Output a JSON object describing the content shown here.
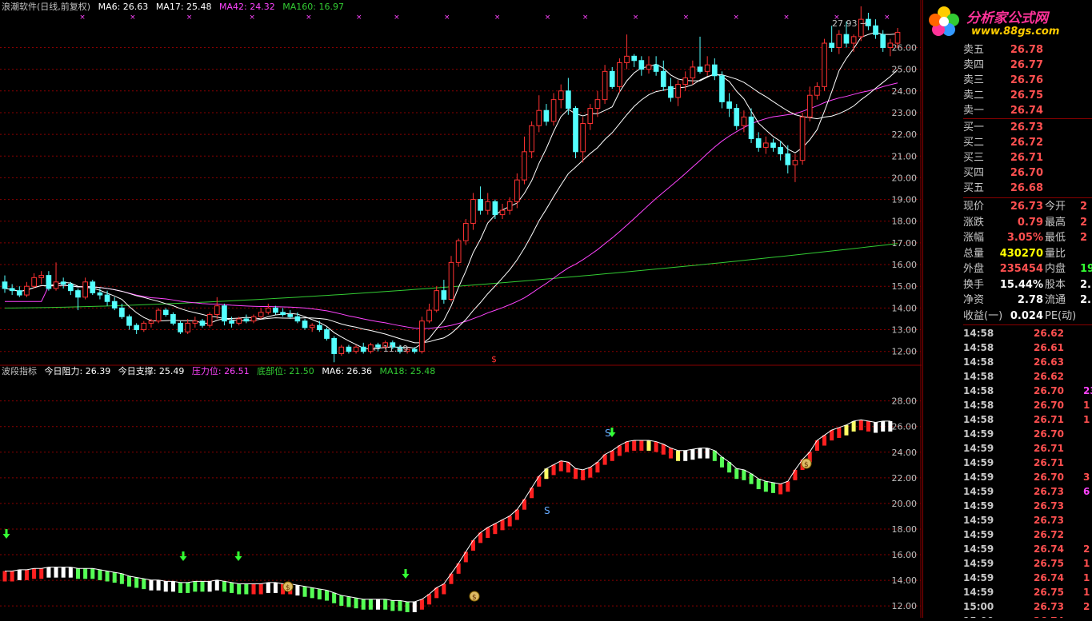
{
  "colors": {
    "up": "#ff3232",
    "down": "#54ffff",
    "ma6": "#ffffff",
    "ma17": "#ffffff",
    "ma42": "#ff44ff",
    "ma160": "#33cc33",
    "grid": "#8a0000",
    "axis": "#c0c0c0"
  },
  "header": {
    "title": "浪潮软件(日线,前复权)",
    "ma6": "MA6: 26.63",
    "ma17": "MA17: 25.48",
    "ma42": "MA42: 24.32",
    "ma160": "MA160: 16.97"
  },
  "sub_header": {
    "name": "波段指标",
    "resist": "今日阻力: 26.39",
    "support": "今日支撑: 25.49",
    "press": "压力位: 26.51",
    "bottom": "底部位: 21.50",
    "ma6": "MA6: 26.36",
    "ma18": "MA18: 25.48"
  },
  "price_axis": {
    "ticks": [
      "26.00",
      "25.00",
      "24.00",
      "23.00",
      "22.00",
      "21.00",
      "20.00",
      "19.00",
      "18.00",
      "17.00",
      "16.00",
      "15.00",
      "14.00",
      "13.00",
      "12.00"
    ]
  },
  "indicator_axis": {
    "ticks": [
      "28.00",
      "26.00",
      "24.00",
      "22.00",
      "20.00",
      "18.00",
      "16.00",
      "14.00",
      "12.00"
    ]
  },
  "annotations": {
    "high": "27.93",
    "low": "11.49",
    "s_marker": "S",
    "dollar": "$"
  },
  "chart_data": {
    "type": "candlestick",
    "ylim": [
      11.4,
      27.6
    ],
    "candles": [
      [
        15.2,
        15.5,
        14.7,
        14.9
      ],
      [
        14.9,
        15.1,
        14.6,
        14.8
      ],
      [
        14.8,
        15.0,
        14.5,
        14.6
      ],
      [
        14.6,
        15.2,
        14.5,
        15.0
      ],
      [
        15.0,
        15.6,
        14.9,
        15.4
      ],
      [
        15.4,
        15.7,
        15.1,
        15.5
      ],
      [
        15.5,
        15.7,
        14.8,
        14.9
      ],
      [
        14.9,
        16.1,
        14.8,
        15.2
      ],
      [
        15.2,
        15.4,
        14.9,
        15.1
      ],
      [
        15.1,
        15.2,
        14.6,
        14.8
      ],
      [
        14.8,
        14.9,
        13.9,
        14.5
      ],
      [
        14.5,
        15.4,
        14.4,
        15.2
      ],
      [
        15.2,
        15.3,
        14.6,
        14.7
      ],
      [
        14.7,
        14.9,
        14.4,
        14.6
      ],
      [
        14.6,
        14.8,
        14.1,
        14.3
      ],
      [
        14.3,
        14.5,
        13.9,
        14.0
      ],
      [
        14.0,
        14.2,
        13.5,
        13.6
      ],
      [
        13.6,
        13.7,
        13.0,
        13.2
      ],
      [
        13.2,
        13.3,
        12.8,
        13.0
      ],
      [
        13.0,
        13.4,
        12.9,
        13.3
      ],
      [
        13.3,
        13.5,
        13.1,
        13.4
      ],
      [
        13.4,
        14.0,
        13.3,
        13.9
      ],
      [
        13.9,
        14.0,
        13.6,
        13.7
      ],
      [
        13.7,
        13.8,
        13.2,
        13.3
      ],
      [
        13.3,
        13.4,
        12.8,
        12.9
      ],
      [
        12.9,
        13.5,
        12.8,
        13.3
      ],
      [
        13.3,
        13.6,
        13.1,
        13.4
      ],
      [
        13.4,
        13.5,
        13.1,
        13.2
      ],
      [
        13.2,
        13.8,
        13.1,
        13.7
      ],
      [
        13.7,
        14.5,
        13.5,
        14.1
      ],
      [
        14.1,
        14.2,
        13.2,
        13.4
      ],
      [
        13.4,
        13.6,
        13.1,
        13.3
      ],
      [
        13.3,
        13.6,
        13.2,
        13.5
      ],
      [
        13.5,
        13.7,
        13.3,
        13.4
      ],
      [
        13.4,
        13.7,
        13.3,
        13.6
      ],
      [
        13.6,
        14.0,
        13.5,
        13.8
      ],
      [
        13.8,
        14.2,
        13.7,
        14.0
      ],
      [
        14.0,
        14.1,
        13.7,
        13.8
      ],
      [
        13.8,
        14.0,
        13.6,
        13.7
      ],
      [
        13.7,
        13.9,
        13.5,
        13.6
      ],
      [
        13.6,
        13.8,
        13.3,
        13.4
      ],
      [
        13.4,
        13.5,
        13.0,
        13.1
      ],
      [
        13.1,
        13.3,
        12.9,
        13.2
      ],
      [
        13.2,
        13.4,
        12.9,
        13.0
      ],
      [
        13.0,
        13.1,
        12.5,
        12.6
      ],
      [
        12.6,
        12.7,
        11.5,
        11.9
      ],
      [
        11.9,
        12.3,
        11.8,
        12.2
      ],
      [
        12.2,
        12.3,
        11.9,
        12.0
      ],
      [
        12.0,
        12.3,
        11.9,
        12.2
      ],
      [
        12.2,
        12.4,
        11.9,
        12.0
      ],
      [
        12.0,
        12.4,
        11.9,
        12.3
      ],
      [
        12.3,
        12.4,
        12.0,
        12.2
      ],
      [
        12.2,
        12.5,
        12.1,
        12.4
      ],
      [
        12.4,
        12.5,
        12.1,
        12.2
      ],
      [
        12.2,
        12.3,
        11.9,
        12.0
      ],
      [
        12.0,
        12.2,
        11.9,
        12.1
      ],
      [
        12.1,
        12.2,
        11.9,
        12.0
      ],
      [
        12.0,
        13.6,
        11.9,
        13.4
      ],
      [
        13.4,
        14.2,
        13.3,
        13.9
      ],
      [
        13.9,
        15.0,
        13.8,
        14.8
      ],
      [
        14.8,
        15.3,
        14.2,
        14.4
      ],
      [
        14.4,
        16.4,
        14.3,
        16.1
      ],
      [
        16.1,
        17.2,
        15.9,
        17.1
      ],
      [
        17.1,
        18.1,
        16.9,
        17.9
      ],
      [
        17.9,
        19.3,
        17.6,
        19.0
      ],
      [
        19.0,
        19.6,
        18.3,
        18.5
      ],
      [
        18.5,
        19.3,
        18.3,
        18.9
      ],
      [
        18.9,
        19.0,
        18.1,
        18.3
      ],
      [
        18.3,
        18.8,
        18.1,
        18.5
      ],
      [
        18.5,
        19.1,
        18.3,
        18.9
      ],
      [
        18.9,
        20.2,
        18.6,
        19.9
      ],
      [
        19.9,
        21.9,
        19.7,
        21.2
      ],
      [
        21.2,
        22.6,
        20.9,
        22.4
      ],
      [
        22.4,
        23.8,
        22.1,
        23.1
      ],
      [
        23.1,
        23.4,
        22.4,
        22.6
      ],
      [
        22.6,
        23.9,
        22.4,
        23.6
      ],
      [
        23.6,
        24.3,
        23.2,
        24.0
      ],
      [
        24.0,
        24.6,
        22.9,
        23.2
      ],
      [
        23.2,
        23.3,
        20.9,
        21.2
      ],
      [
        21.2,
        22.8,
        20.7,
        22.5
      ],
      [
        22.5,
        23.4,
        22.2,
        23.2
      ],
      [
        23.2,
        24.0,
        22.8,
        23.6
      ],
      [
        23.6,
        25.2,
        23.4,
        24.9
      ],
      [
        24.9,
        25.1,
        24.1,
        24.2
      ],
      [
        24.2,
        25.5,
        23.9,
        25.3
      ],
      [
        25.3,
        26.6,
        25.0,
        25.6
      ],
      [
        25.6,
        25.7,
        25.1,
        25.4
      ],
      [
        25.4,
        25.6,
        24.7,
        25.0
      ],
      [
        25.0,
        25.6,
        24.8,
        25.2
      ],
      [
        25.2,
        25.6,
        24.7,
        24.9
      ],
      [
        24.9,
        25.4,
        24.0,
        24.2
      ],
      [
        24.2,
        24.6,
        23.5,
        23.7
      ],
      [
        23.7,
        24.5,
        23.3,
        24.3
      ],
      [
        24.3,
        24.9,
        24.0,
        24.6
      ],
      [
        24.6,
        25.4,
        24.3,
        25.1
      ],
      [
        25.1,
        26.5,
        24.8,
        24.9
      ],
      [
        24.9,
        25.6,
        24.7,
        25.2
      ],
      [
        25.2,
        25.5,
        24.5,
        24.7
      ],
      [
        24.7,
        24.9,
        23.2,
        23.5
      ],
      [
        23.5,
        23.9,
        22.8,
        23.2
      ],
      [
        23.2,
        23.4,
        22.2,
        22.4
      ],
      [
        22.4,
        23.1,
        22.1,
        22.8
      ],
      [
        22.8,
        23.2,
        21.6,
        21.8
      ],
      [
        21.8,
        22.1,
        21.2,
        21.4
      ],
      [
        21.4,
        21.9,
        21.1,
        21.6
      ],
      [
        21.6,
        21.8,
        21.2,
        21.4
      ],
      [
        21.4,
        21.7,
        20.8,
        21.1
      ],
      [
        21.1,
        21.5,
        20.2,
        20.6
      ],
      [
        20.6,
        21.1,
        19.8,
        20.8
      ],
      [
        20.8,
        23.0,
        20.6,
        22.8
      ],
      [
        22.8,
        24.2,
        22.6,
        23.8
      ],
      [
        23.8,
        24.4,
        23.6,
        24.2
      ],
      [
        24.2,
        26.4,
        24.0,
        26.2
      ],
      [
        26.2,
        27.0,
        25.8,
        26.0
      ],
      [
        26.0,
        26.8,
        25.7,
        26.6
      ],
      [
        26.6,
        27.2,
        26.0,
        26.2
      ],
      [
        26.2,
        26.6,
        25.8,
        26.5
      ],
      [
        26.5,
        27.9,
        26.3,
        27.3
      ],
      [
        27.3,
        27.6,
        26.8,
        27.0
      ],
      [
        27.0,
        27.3,
        26.4,
        26.6
      ],
      [
        26.6,
        26.8,
        25.8,
        26.0
      ],
      [
        26.0,
        26.4,
        25.6,
        26.2
      ],
      [
        26.2,
        26.9,
        26.0,
        26.7
      ]
    ]
  },
  "indicator_data": {
    "ylim": [
      11.2,
      29.6
    ],
    "values": [
      14.6,
      14.6,
      14.7,
      14.7,
      14.8,
      14.8,
      14.9,
      14.9,
      14.9,
      14.9,
      14.8,
      14.8,
      14.8,
      14.7,
      14.6,
      14.5,
      14.4,
      14.2,
      14.1,
      14.0,
      13.9,
      13.9,
      13.8,
      13.8,
      13.7,
      13.7,
      13.8,
      13.8,
      13.8,
      13.9,
      13.8,
      13.7,
      13.6,
      13.6,
      13.6,
      13.6,
      13.7,
      13.7,
      13.6,
      13.6,
      13.5,
      13.4,
      13.3,
      13.2,
      13.1,
      12.9,
      12.7,
      12.6,
      12.5,
      12.4,
      12.4,
      12.4,
      12.4,
      12.3,
      12.3,
      12.2,
      12.2,
      12.4,
      12.8,
      13.3,
      13.6,
      14.4,
      15.2,
      16.1,
      17.0,
      17.6,
      18.0,
      18.3,
      18.6,
      18.9,
      19.4,
      20.2,
      21.1,
      22.0,
      22.6,
      22.9,
      23.2,
      23.1,
      22.6,
      22.5,
      22.7,
      23.1,
      23.7,
      24.0,
      24.4,
      24.7,
      24.8,
      24.8,
      24.8,
      24.7,
      24.5,
      24.2,
      24.0,
      24.0,
      24.1,
      24.2,
      24.2,
      24.0,
      23.5,
      23.1,
      22.6,
      22.5,
      22.2,
      21.8,
      21.6,
      21.5,
      21.4,
      21.6,
      22.5,
      23.3,
      23.9,
      24.8,
      25.2,
      25.6,
      25.8,
      26.0,
      26.3,
      26.4,
      26.3,
      26.2,
      26.3,
      26.3
    ],
    "states": [
      "r",
      "r",
      "w",
      "r",
      "r",
      "r",
      "w",
      "w",
      "w",
      "w",
      "g",
      "g",
      "g",
      "g",
      "g",
      "g",
      "g",
      "g",
      "g",
      "g",
      "w",
      "w",
      "w",
      "w",
      "g",
      "g",
      "g",
      "g",
      "w",
      "w",
      "g",
      "g",
      "g",
      "g",
      "r",
      "r",
      "w",
      "w",
      "r",
      "r",
      "w",
      "g",
      "g",
      "g",
      "g",
      "g",
      "g",
      "g",
      "g",
      "g",
      "g",
      "w",
      "g",
      "g",
      "g",
      "g",
      "w",
      "r",
      "r",
      "r",
      "r",
      "r",
      "r",
      "r",
      "r",
      "r",
      "r",
      "r",
      "r",
      "r",
      "r",
      "r",
      "r",
      "r",
      "y",
      "r",
      "r",
      "r",
      "r",
      "r",
      "r",
      "r",
      "r",
      "r",
      "r",
      "r",
      "r",
      "r",
      "y",
      "r",
      "r",
      "r",
      "y",
      "w",
      "w",
      "w",
      "w",
      "g",
      "g",
      "g",
      "g",
      "g",
      "g",
      "g",
      "g",
      "g",
      "r",
      "r",
      "r",
      "r",
      "r",
      "r",
      "r",
      "r",
      "r",
      "y",
      "y",
      "r",
      "r"
    ]
  },
  "quote": {
    "asks": [
      {
        "label": "卖五",
        "price": "26.78"
      },
      {
        "label": "卖四",
        "price": "26.77"
      },
      {
        "label": "卖三",
        "price": "26.76"
      },
      {
        "label": "卖二",
        "price": "26.75"
      },
      {
        "label": "卖一",
        "price": "26.74"
      }
    ],
    "bids": [
      {
        "label": "买一",
        "price": "26.73"
      },
      {
        "label": "买二",
        "price": "26.72"
      },
      {
        "label": "买三",
        "price": "26.71"
      },
      {
        "label": "买四",
        "price": "26.70"
      },
      {
        "label": "买五",
        "price": "26.68"
      }
    ],
    "stats": [
      {
        "l1": "现价",
        "v1": "26.73",
        "c1": "#ff5050",
        "l2": "今开",
        "v2": "2",
        "c2": "#ff5050"
      },
      {
        "l1": "涨跌",
        "v1": "0.79",
        "c1": "#ff5050",
        "l2": "最高",
        "v2": "2",
        "c2": "#ff5050"
      },
      {
        "l1": "涨幅",
        "v1": "3.05%",
        "c1": "#ff5050",
        "l2": "最低",
        "v2": "2",
        "c2": "#ff5050"
      },
      {
        "l1": "总量",
        "v1": "430270",
        "c1": "#ffff00",
        "l2": "量比",
        "v2": "",
        "c2": "#ff5050"
      },
      {
        "l1": "外盘",
        "v1": "235454",
        "c1": "#ff5050",
        "l2": "内盘",
        "v2": "19",
        "c2": "#33ff33"
      },
      {
        "l1": "换手",
        "v1": "15.44%",
        "c1": "#ffffff",
        "l2": "股本",
        "v2": "2.",
        "c2": "#ffffff"
      },
      {
        "l1": "净资",
        "v1": "2.78",
        "c1": "#ffffff",
        "l2": "流通",
        "v2": "2.",
        "c2": "#ffffff"
      },
      {
        "l1": "收益(一)",
        "v1": "0.024",
        "c1": "#ffffff",
        "l2": "PE(动)",
        "v2": "",
        "c2": "#ffffff"
      }
    ],
    "ticks": [
      {
        "t": "14:58",
        "p": "26.62",
        "v": "",
        "vc": "#ff5050"
      },
      {
        "t": "14:58",
        "p": "26.61",
        "v": "",
        "vc": "#ff5050"
      },
      {
        "t": "14:58",
        "p": "26.63",
        "v": "",
        "vc": "#ff5050"
      },
      {
        "t": "14:58",
        "p": "26.62",
        "v": "",
        "vc": "#ff5050"
      },
      {
        "t": "14:58",
        "p": "26.70",
        "v": "23",
        "vc": "#ff44ff"
      },
      {
        "t": "14:58",
        "p": "26.70",
        "v": "1",
        "vc": "#ff5050"
      },
      {
        "t": "14:58",
        "p": "26.71",
        "v": "1",
        "vc": "#ff5050"
      },
      {
        "t": "14:59",
        "p": "26.70",
        "v": "",
        "vc": "#ff5050"
      },
      {
        "t": "14:59",
        "p": "26.71",
        "v": "",
        "vc": "#ff5050"
      },
      {
        "t": "14:59",
        "p": "26.71",
        "v": "",
        "vc": "#ff5050"
      },
      {
        "t": "14:59",
        "p": "26.70",
        "v": "3",
        "vc": "#ff5050"
      },
      {
        "t": "14:59",
        "p": "26.73",
        "v": "6",
        "vc": "#ff44ff"
      },
      {
        "t": "14:59",
        "p": "26.73",
        "v": "",
        "vc": "#ff5050"
      },
      {
        "t": "14:59",
        "p": "26.73",
        "v": "",
        "vc": "#ff5050"
      },
      {
        "t": "14:59",
        "p": "26.72",
        "v": "",
        "vc": "#ff5050"
      },
      {
        "t": "14:59",
        "p": "26.74",
        "v": "2",
        "vc": "#ff5050"
      },
      {
        "t": "14:59",
        "p": "26.75",
        "v": "1",
        "vc": "#ff5050"
      },
      {
        "t": "14:59",
        "p": "26.74",
        "v": "1",
        "vc": "#ff5050"
      },
      {
        "t": "14:59",
        "p": "26.75",
        "v": "1",
        "vc": "#ff5050"
      },
      {
        "t": "15:00",
        "p": "26.73",
        "v": "2",
        "vc": "#ff5050"
      },
      {
        "t": "15:00",
        "p": "26.74",
        "v": "",
        "vc": "#ff5050"
      }
    ]
  },
  "logo": {
    "name": "分析家公式网",
    "url": "www.88gs.com"
  }
}
